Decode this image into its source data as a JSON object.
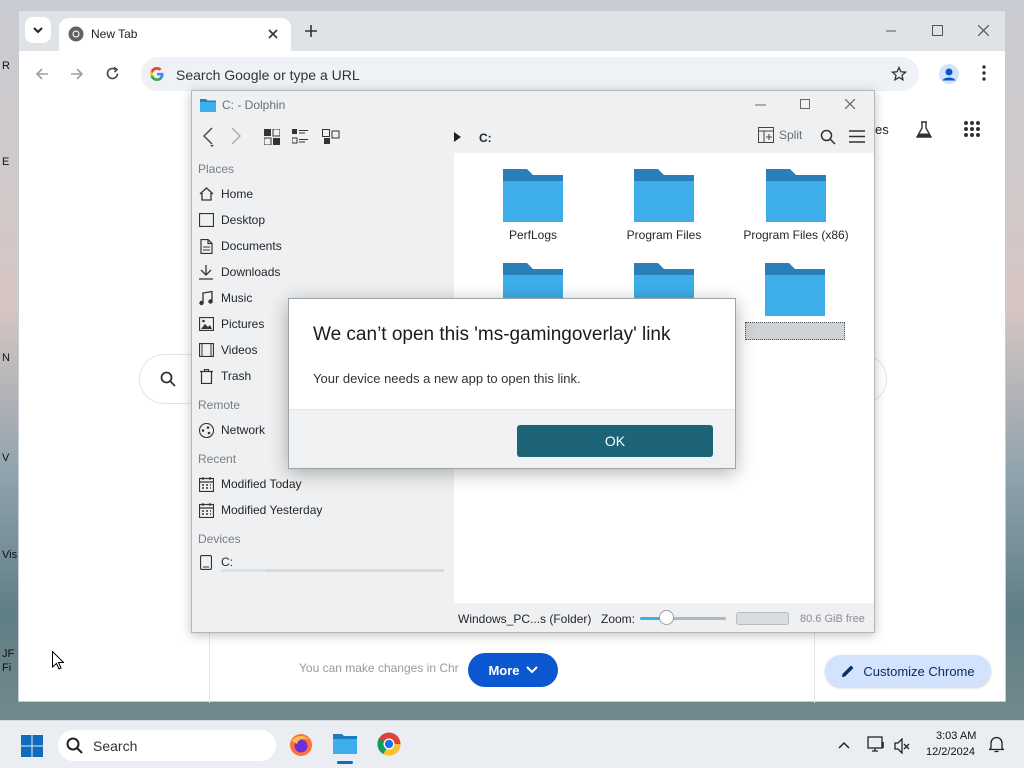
{
  "browser": {
    "tab_title": "New Tab",
    "omnibox_placeholder": "Search Google or type a URL",
    "ntp_hint": "You can make changes in Chr",
    "more_label": "More",
    "customize_label": "Customize Chrome",
    "partial_header_text": "es"
  },
  "desktop": {
    "edge_labels": [
      "R",
      "E",
      "N",
      "V",
      "Vis",
      "JF",
      "Fi"
    ]
  },
  "dolphin": {
    "title": "C: - Dolphin",
    "breadcrumb": "C:",
    "split_label": "Split",
    "sidebar": {
      "places_heading": "Places",
      "places": [
        "Home",
        "Desktop",
        "Documents",
        "Downloads",
        "Music",
        "Pictures",
        "Videos",
        "Trash"
      ],
      "remote_heading": "Remote",
      "remote": [
        "Network"
      ],
      "recent_heading": "Recent",
      "recent": [
        "Modified Today",
        "Modified Yesterday"
      ],
      "devices_heading": "Devices",
      "devices": [
        "C:"
      ]
    },
    "folders": [
      "PerfLogs",
      "Program Files",
      "Program Files (x86)"
    ],
    "status": {
      "selection": "Windows_PC...s (Folder)",
      "zoom_label": "Zoom:",
      "free_space": "80.6 GiB free"
    }
  },
  "dialog": {
    "title": "We can’t open this 'ms-gamingoverlay' link",
    "message": "Your device needs a new app to open this link.",
    "ok_label": "OK"
  },
  "taskbar": {
    "search_label": "Search",
    "time": "3:03 AM",
    "date": "12/2/2024"
  },
  "colors": {
    "folder_blue": "#3daee9",
    "ok_button": "#1e6479",
    "more_button": "#0b57d0"
  }
}
